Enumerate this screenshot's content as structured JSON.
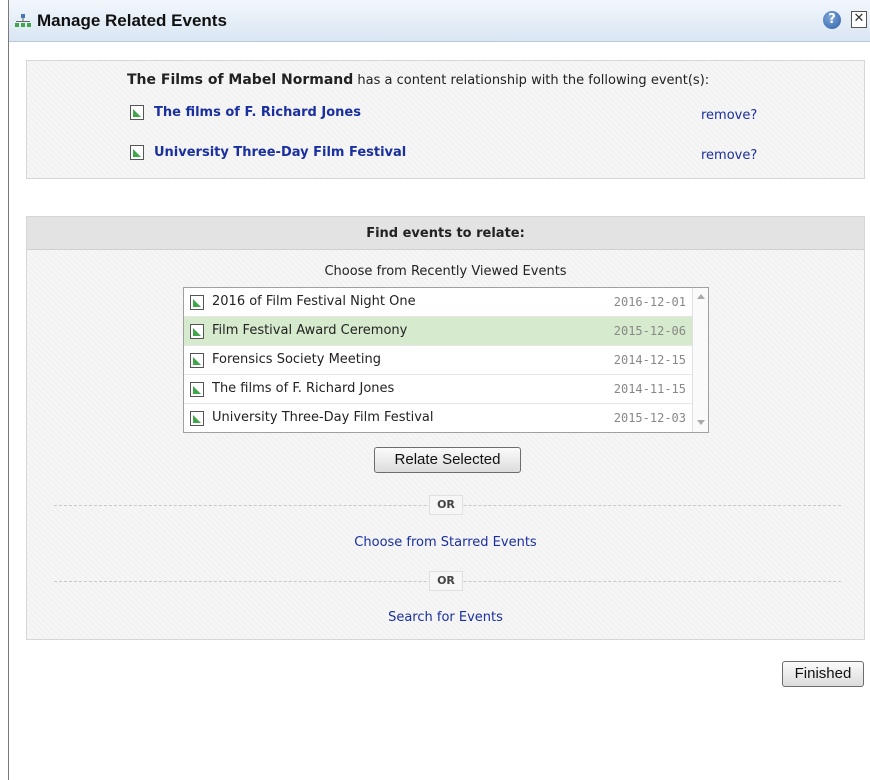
{
  "dialog": {
    "title": "Manage Related Events",
    "help_icon": "help-icon",
    "close_icon": "close-icon",
    "help_glyph": "?",
    "close_glyph": "✕"
  },
  "relationships": {
    "subject": "The Films of Mabel Normand",
    "description": "has a content relationship with the following event(s):",
    "items": [
      {
        "title": "The films of F. Richard Jones",
        "action": "remove?"
      },
      {
        "title": "University Three-Day Film Festival",
        "action": "remove?"
      }
    ]
  },
  "find": {
    "header": "Find events to relate:",
    "recent_label": "Choose from Recently Viewed Events",
    "recent_events": [
      {
        "title": "2016 of Film Festival Night One",
        "date": "2016-12-01",
        "selected": false
      },
      {
        "title": "Film Festival Award Ceremony",
        "date": "2015-12-06",
        "selected": true
      },
      {
        "title": "Forensics Society Meeting",
        "date": "2014-12-15",
        "selected": false
      },
      {
        "title": "The films of F. Richard Jones",
        "date": "2014-11-15",
        "selected": false
      },
      {
        "title": "University Three-Day Film Festival",
        "date": "2015-12-03",
        "selected": false
      }
    ],
    "relate_button": "Relate Selected",
    "or_label_1": "OR",
    "starred_link": "Choose from Starred Events",
    "or_label_2": "OR",
    "search_link": "Search for Events"
  },
  "footer": {
    "finished_button": "Finished"
  },
  "colors": {
    "link": "#1a2fa0",
    "selected_row": "#d6eacd",
    "doc_icon_green": "#3fa64a"
  }
}
